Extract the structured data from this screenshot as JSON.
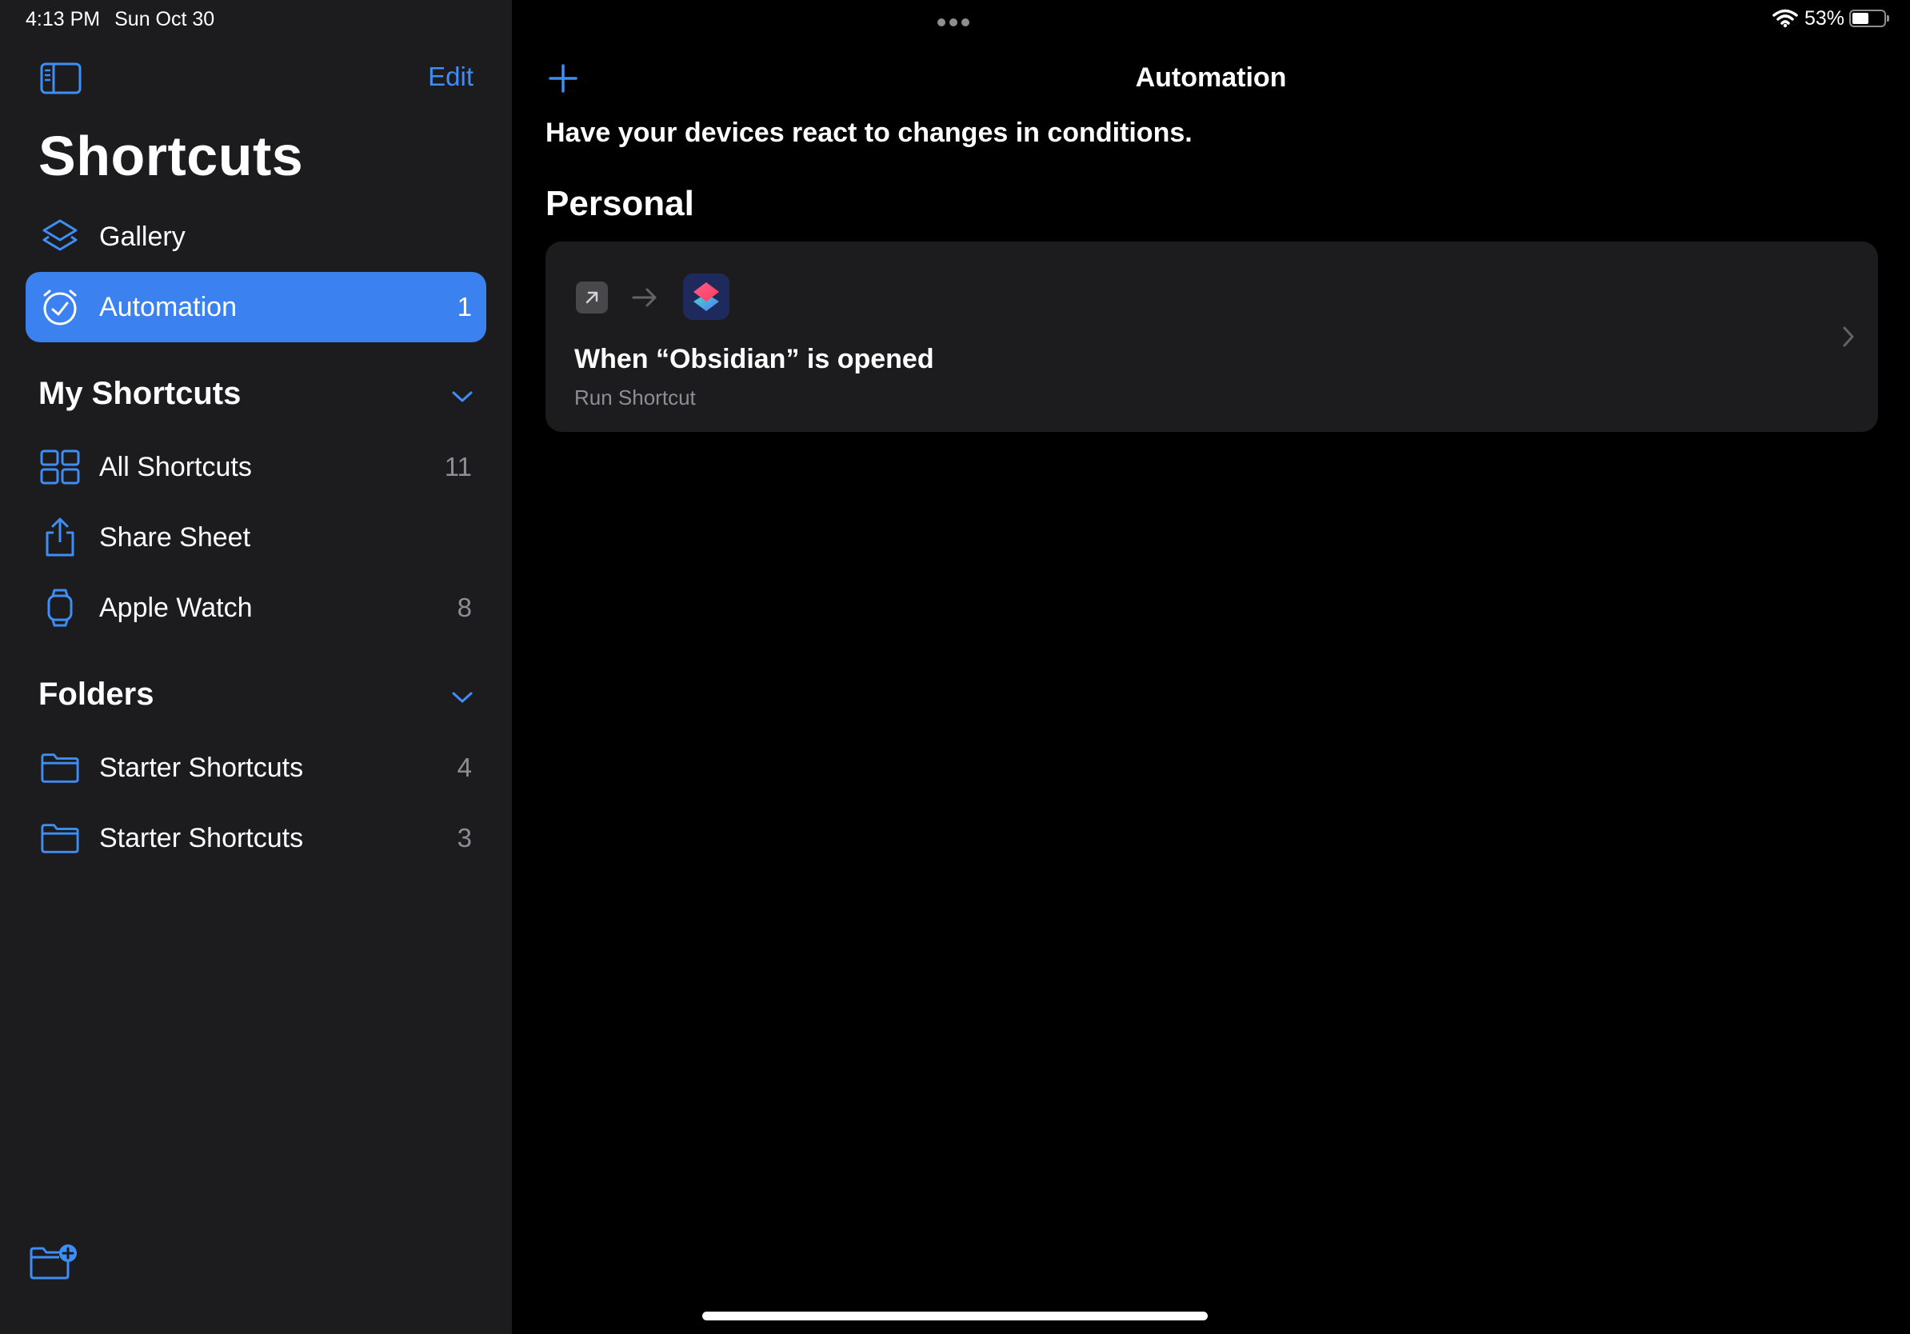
{
  "status_bar": {
    "time": "4:13 PM",
    "date": "Sun Oct 30",
    "battery": "53%",
    "battery_level": 0.53
  },
  "sidebar": {
    "edit_label": "Edit",
    "title": "Shortcuts",
    "top_items": [
      {
        "label": "Gallery",
        "icon": "gallery-layers-icon",
        "count": ""
      },
      {
        "label": "Automation",
        "icon": "automation-clock-icon",
        "count": "1",
        "selected": true
      }
    ],
    "my_shortcuts": {
      "header": "My Shortcuts",
      "items": [
        {
          "label": "All Shortcuts",
          "icon": "grid-icon",
          "count": "11"
        },
        {
          "label": "Share Sheet",
          "icon": "share-icon",
          "count": ""
        },
        {
          "label": "Apple Watch",
          "icon": "watch-icon",
          "count": "8"
        }
      ]
    },
    "folders": {
      "header": "Folders",
      "items": [
        {
          "label": "Starter Shortcuts",
          "icon": "folder-icon",
          "count": "4"
        },
        {
          "label": "Starter Shortcuts",
          "icon": "folder-icon",
          "count": "3"
        }
      ]
    }
  },
  "main": {
    "nav_title": "Automation",
    "subtitle": "Have your devices react to changes in conditions.",
    "section_header": "Personal",
    "automation": {
      "title": "When “Obsidian” is opened",
      "action": "Run Shortcut"
    }
  },
  "colors": {
    "accent": "#3e8ef7",
    "selected_bg": "#3b82f0",
    "sidebar_bg": "#1c1c1e",
    "card_bg": "#1c1c1e",
    "main_bg": "#000000",
    "secondary_text": "#8e8e93"
  }
}
